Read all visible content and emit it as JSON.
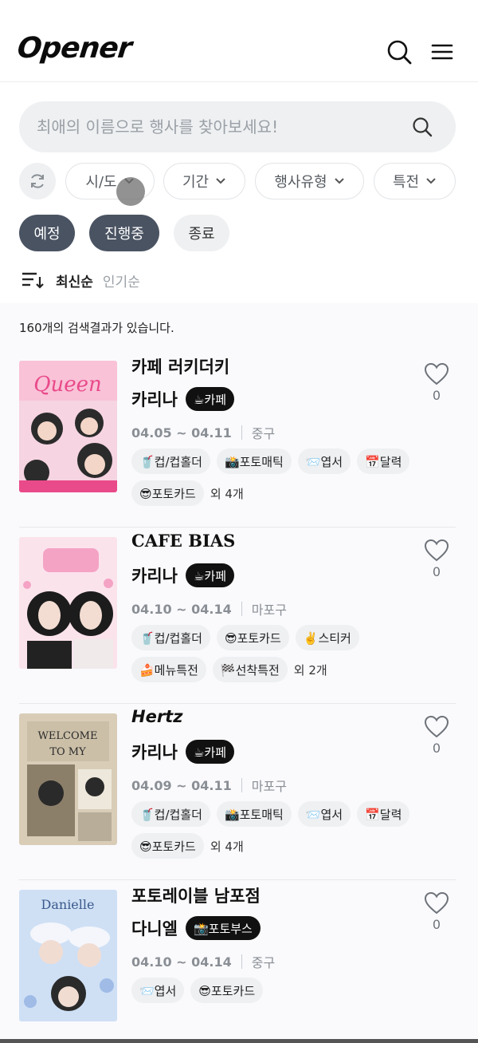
{
  "header": {
    "logo": "Opener",
    "search_icon": "search-icon",
    "menu_icon": "menu-icon"
  },
  "search": {
    "placeholder": "최애의 이름으로 행사를 찾아보세요!"
  },
  "filters": {
    "refresh_icon": "refresh-icon",
    "chips": [
      "시/도",
      "기간",
      "행사유형",
      "특전"
    ]
  },
  "status_filters": [
    {
      "label": "예정",
      "active": true
    },
    {
      "label": "진행중",
      "active": true
    },
    {
      "label": "종료",
      "active": false
    }
  ],
  "sort": {
    "icon": "sort-icon",
    "selected": "최신순",
    "other": "인기순"
  },
  "result_count": "160개의 검색결과가 있습니다.",
  "events": [
    {
      "title": "카페 러키더키",
      "artist": "카리나",
      "type": "☕카페",
      "dates": "04.05 ~ 04.11",
      "district": "중구",
      "tags_line1": [
        "🥤컵/컵홀더",
        "📸포토매틱",
        "📨엽서",
        "📅달력"
      ],
      "tags_line2": [
        "😎포토카드"
      ],
      "more": "외 4개",
      "likes": "0",
      "poster_colors": [
        "#f6b8cf",
        "#e94a8a",
        "#2b2b2b"
      ]
    },
    {
      "title": "CAFE BIAS",
      "artist": "카리나",
      "type": "☕카페",
      "dates": "04.10 ~ 04.14",
      "district": "마포구",
      "tags_line1": [
        "🥤컵/컵홀더",
        "😎포토카드",
        "✌️스티커"
      ],
      "tags_line2": [
        "🍰메뉴특전",
        "🏁선착특전"
      ],
      "more": "외 2개",
      "likes": "0",
      "poster_colors": [
        "#fbe3ec",
        "#f4a3c4",
        "#1c1c1c"
      ]
    },
    {
      "title": "Hertz",
      "artist": "카리나",
      "type": "☕카페",
      "dates": "04.09 ~ 04.11",
      "district": "마포구",
      "tags_line1": [
        "🥤컵/컵홀더",
        "📸포토매틱",
        "📨엽서",
        "📅달력"
      ],
      "tags_line2": [
        "😎포토카드"
      ],
      "more": "외 4개",
      "likes": "0",
      "poster_colors": [
        "#d9cdb8",
        "#8c7f6a",
        "#2a2a2a"
      ]
    },
    {
      "title": "포토레이블 남포점",
      "artist": "다니엘",
      "type": "📸포토부스",
      "dates": "04.10 ~ 04.14",
      "district": "중구",
      "tags_line1": [
        "📨엽서",
        "😎포토카드"
      ],
      "tags_line2": [],
      "more": "",
      "likes": "0",
      "poster_colors": [
        "#cfe0f5",
        "#9fbbe6",
        "#e8eef8"
      ]
    }
  ]
}
